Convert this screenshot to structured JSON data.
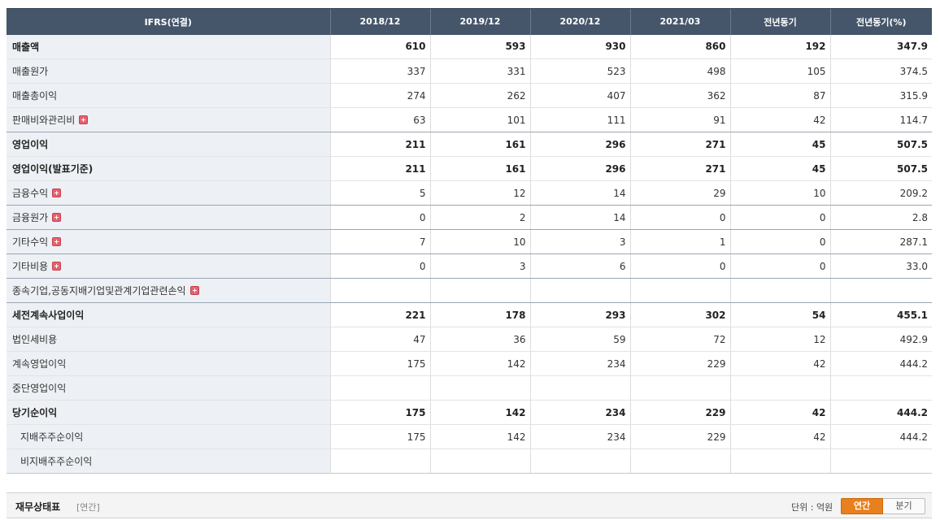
{
  "table": {
    "header": [
      "IFRS(연결)",
      "2018/12",
      "2019/12",
      "2020/12",
      "2021/03",
      "전년동기",
      "전년동기(%)"
    ],
    "rows": [
      {
        "label": "매출액",
        "values": [
          "610",
          "593",
          "930",
          "860",
          "192",
          "347.9"
        ]
      },
      {
        "label": "매출원가",
        "values": [
          "337",
          "331",
          "523",
          "498",
          "105",
          "374.5"
        ]
      },
      {
        "label": "매출총이익",
        "values": [
          "274",
          "262",
          "407",
          "362",
          "87",
          "315.9"
        ]
      },
      {
        "label": "판매비와관리비",
        "values": [
          "63",
          "101",
          "111",
          "91",
          "42",
          "114.7"
        ]
      },
      {
        "label": "영업이익",
        "values": [
          "211",
          "161",
          "296",
          "271",
          "45",
          "507.5"
        ]
      },
      {
        "label": "영업이익(발표기준)",
        "values": [
          "211",
          "161",
          "296",
          "271",
          "45",
          "507.5"
        ]
      },
      {
        "label": "금융수익",
        "values": [
          "5",
          "12",
          "14",
          "29",
          "10",
          "209.2"
        ]
      },
      {
        "label": "금융원가",
        "values": [
          "0",
          "2",
          "14",
          "0",
          "0",
          "2.8"
        ]
      },
      {
        "label": "기타수익",
        "values": [
          "7",
          "10",
          "3",
          "1",
          "0",
          "287.1"
        ]
      },
      {
        "label": "기타비용",
        "values": [
          "0",
          "3",
          "6",
          "0",
          "0",
          "33.0"
        ]
      },
      {
        "label": "종속기업,공동지배기업및관계기업관련손익",
        "values": [
          "",
          "",
          "",
          "",
          "",
          ""
        ]
      },
      {
        "label": "세전계속사업이익",
        "values": [
          "221",
          "178",
          "293",
          "302",
          "54",
          "455.1"
        ]
      },
      {
        "label": "법인세비용",
        "values": [
          "47",
          "36",
          "59",
          "72",
          "12",
          "492.9"
        ]
      },
      {
        "label": "계속영업이익",
        "values": [
          "175",
          "142",
          "234",
          "229",
          "42",
          "444.2"
        ]
      },
      {
        "label": "중단영업이익",
        "values": [
          "",
          "",
          "",
          "",
          "",
          ""
        ]
      },
      {
        "label": "당기순이익",
        "values": [
          "175",
          "142",
          "234",
          "229",
          "42",
          "444.2"
        ]
      },
      {
        "label": "지배주주순이익",
        "values": [
          "175",
          "142",
          "234",
          "229",
          "42",
          "444.2"
        ]
      },
      {
        "label": "비지배주주순이익",
        "values": [
          "",
          "",
          "",
          "",
          "",
          ""
        ]
      }
    ]
  },
  "bottom": {
    "title": "재무상태표",
    "subtitle": "[연간]",
    "unit": "단위 : 억원",
    "toggle_annual": "연간",
    "toggle_quarter": "분기"
  },
  "colors": {
    "header_bg": "#45566a",
    "label_bg": "#edf1f5",
    "accent_orange": "#e8801e",
    "plus_icon": "#e4626f"
  }
}
